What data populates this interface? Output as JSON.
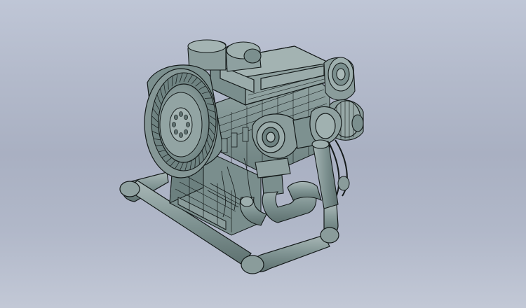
{
  "scene": {
    "background_top": "#bfc6d6",
    "background_bottom": "#c2c8d6",
    "model_fill": "#7b8f8e",
    "model_fill_light": "#93a5a4",
    "model_fill_dark": "#5f7170",
    "edge_color": "#141a1a"
  }
}
